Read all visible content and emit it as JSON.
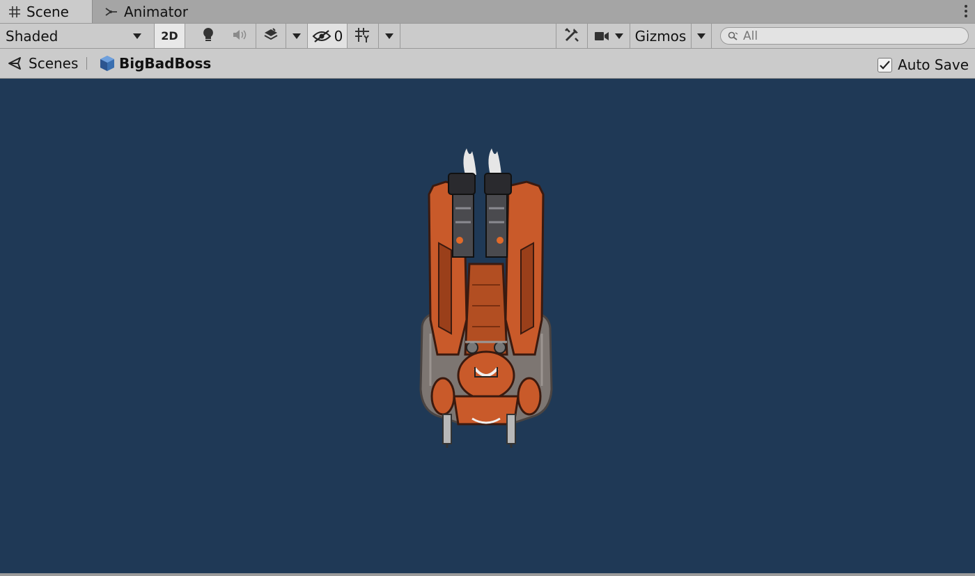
{
  "tabs": [
    {
      "label": "Scene",
      "icon": "grid-hash-icon",
      "active": true
    },
    {
      "label": "Animator",
      "icon": "animator-icon",
      "active": false
    }
  ],
  "toolbar": {
    "draw_mode": "Shaded",
    "mode_2d_label": "2D",
    "hidden_count": "0",
    "gizmos_label": "Gizmos",
    "search_placeholder": "All"
  },
  "breadcrumb": {
    "root_label": "Scenes",
    "prefab_label": "BigBadBoss"
  },
  "auto_save": {
    "label": "Auto Save",
    "checked": true
  },
  "viewport": {
    "background_color": "#1f3956",
    "sprite_name": "boss-spaceship-sprite"
  },
  "colors": {
    "panel": "#cbcbcb",
    "tab_bar": "#a5a5a5",
    "ship_orange": "#c95a2a",
    "ship_grey": "#7d7672"
  }
}
